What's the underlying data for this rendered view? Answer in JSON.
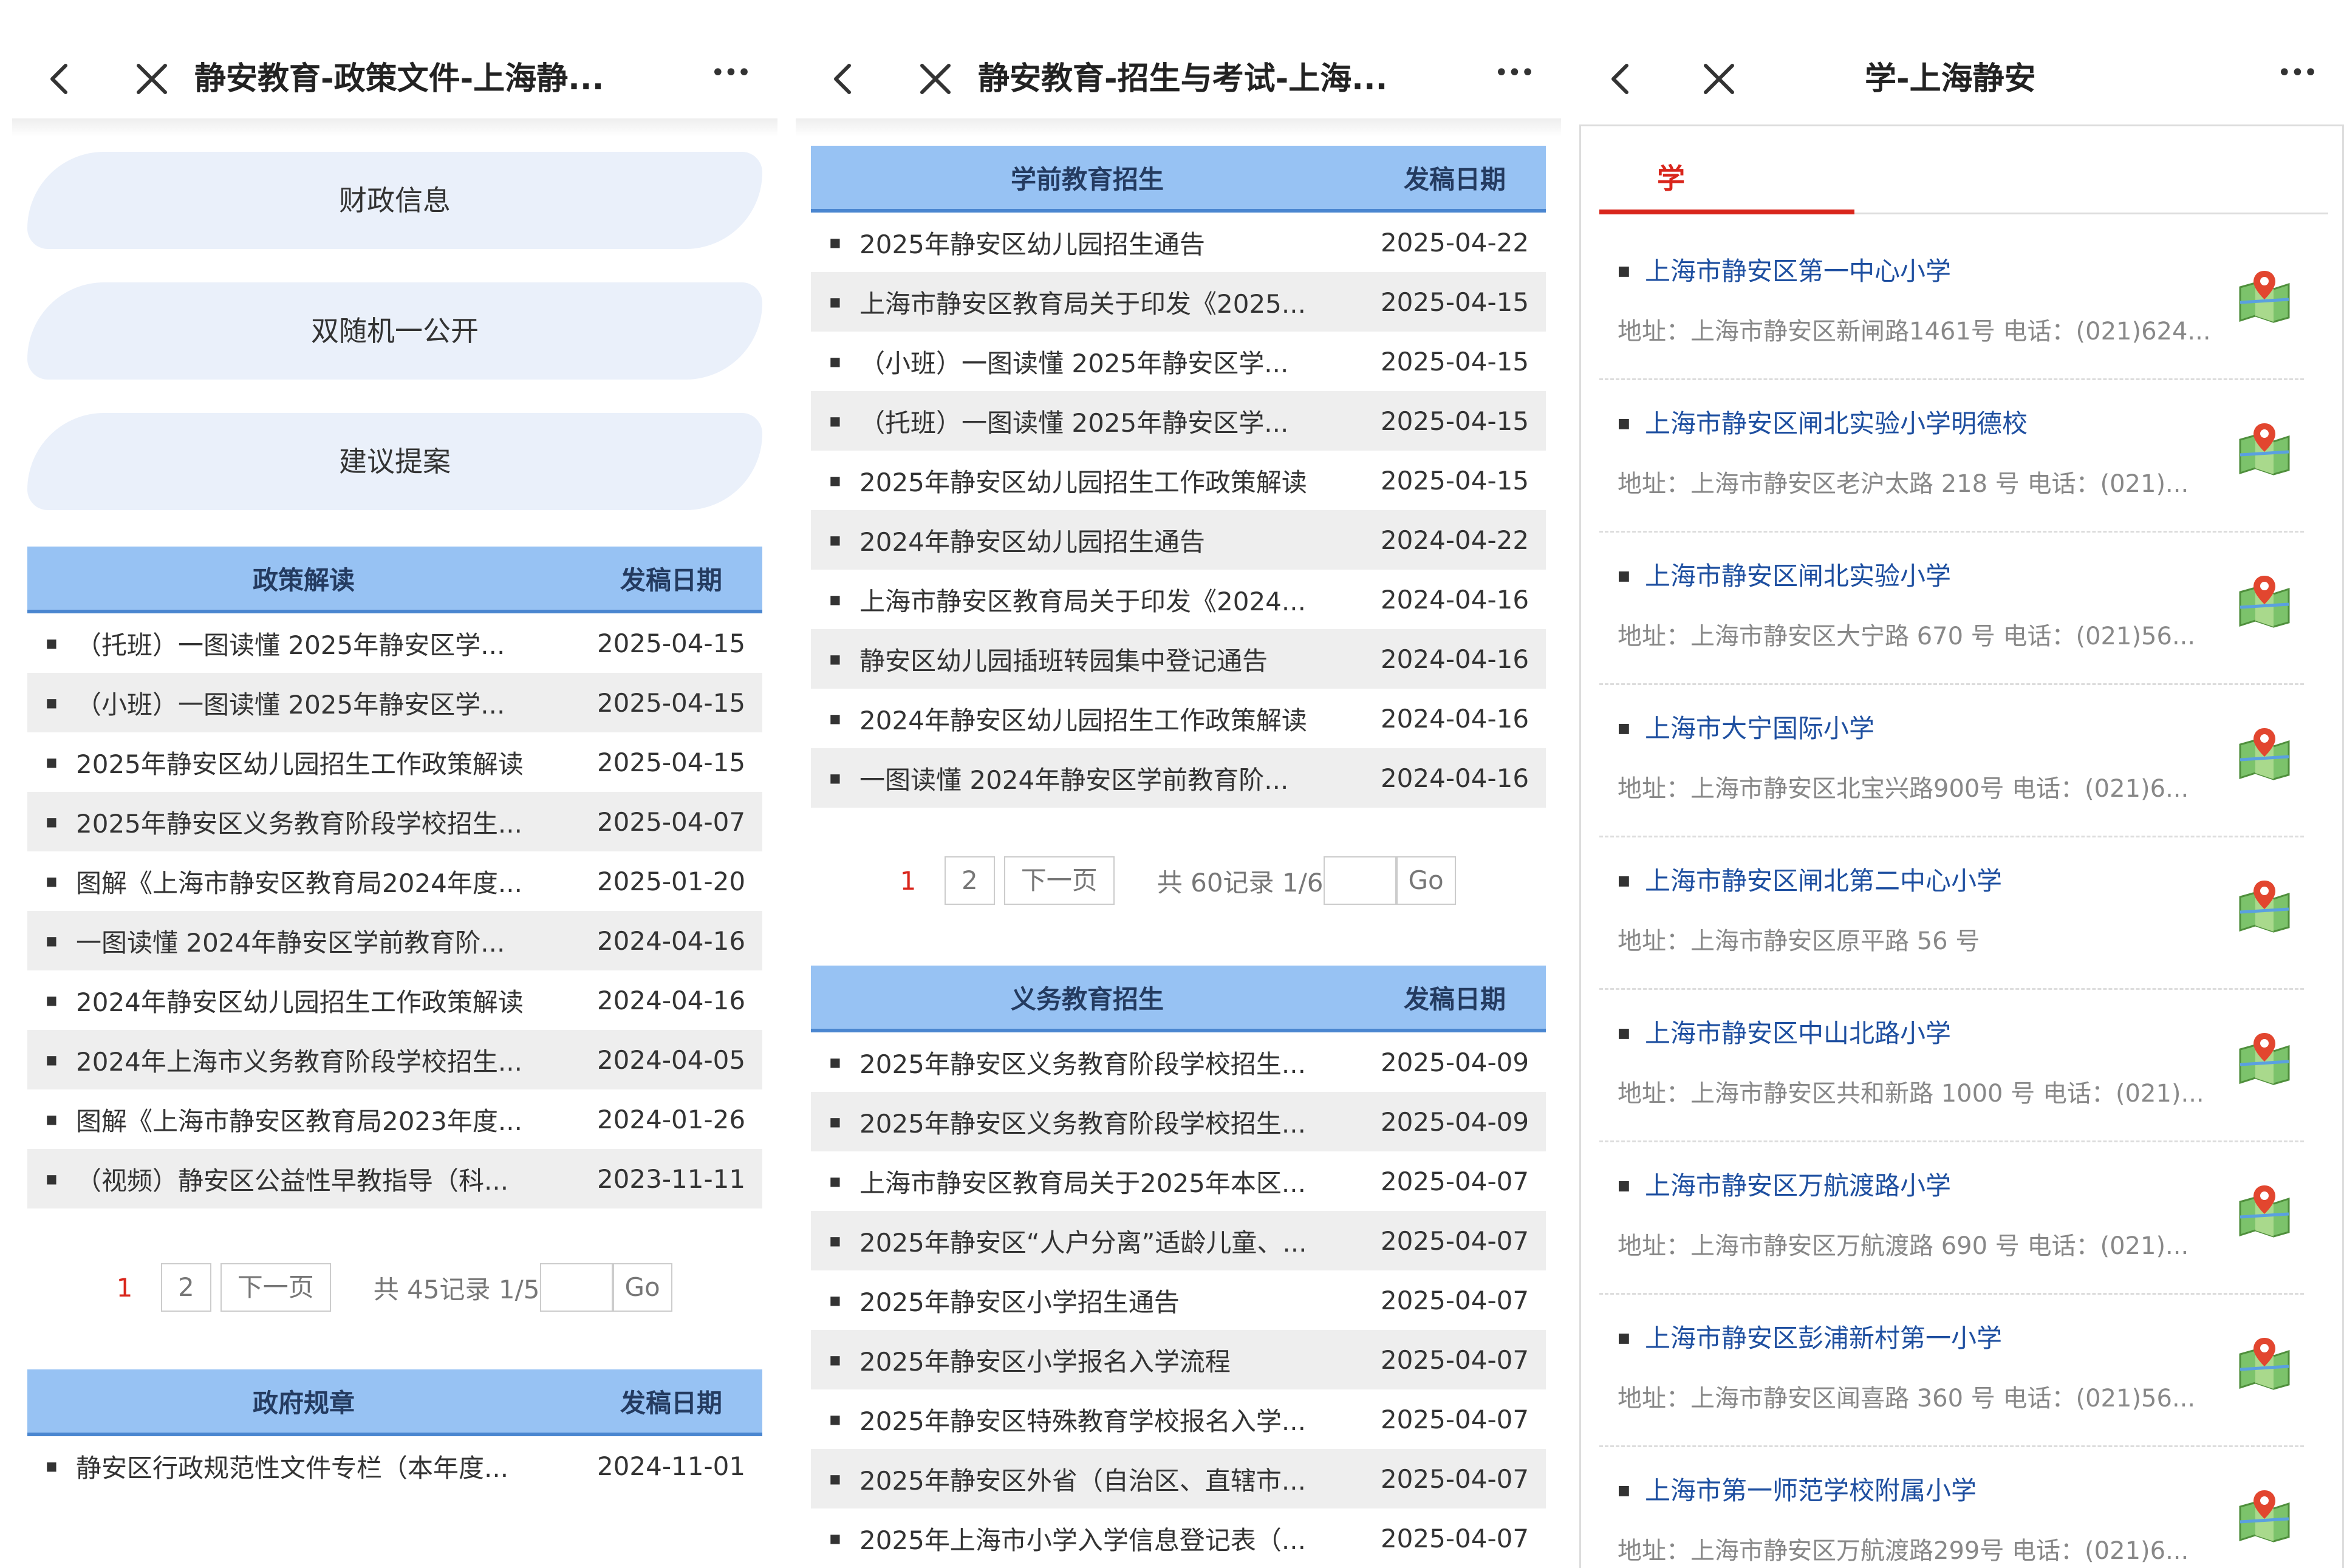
{
  "screen1": {
    "title": "静安教育-政策文件-上海静...",
    "tabs": [
      "财政信息",
      "双随机一公开",
      "建议提案"
    ],
    "table1": {
      "col1": "政策解读",
      "col2": "发稿日期",
      "rows": [
        {
          "text": "（托班）一图读懂 2025年静安区学...",
          "date": "2025-04-15"
        },
        {
          "text": "（小班）一图读懂 2025年静安区学...",
          "date": "2025-04-15"
        },
        {
          "text": "2025年静安区幼儿园招生工作政策解读",
          "date": "2025-04-15"
        },
        {
          "text": "2025年静安区义务教育阶段学校招生...",
          "date": "2025-04-07"
        },
        {
          "text": "图解《上海市静安区教育局2024年度...",
          "date": "2025-01-20"
        },
        {
          "text": "一图读懂 2024年静安区学前教育阶...",
          "date": "2024-04-16"
        },
        {
          "text": "2024年静安区幼儿园招生工作政策解读",
          "date": "2024-04-16"
        },
        {
          "text": "2024年上海市义务教育阶段学校招生...",
          "date": "2024-04-05"
        },
        {
          "text": "图解《上海市静安区教育局2023年度...",
          "date": "2024-01-26"
        },
        {
          "text": "（视频）静安区公益性早教指导（科...",
          "date": "2023-11-11"
        }
      ]
    },
    "pager": {
      "current": "1",
      "page2": "2",
      "next": "下一页",
      "info": "共 45记录 1/5",
      "go": "Go"
    },
    "table2": {
      "col1": "政府规章",
      "col2": "发稿日期",
      "rows": [
        {
          "text": "静安区行政规范性文件专栏（本年度...",
          "date": "2024-11-01"
        }
      ]
    }
  },
  "screen2": {
    "title": "静安教育-招生与考试-上海...",
    "table1": {
      "col1": "学前教育招生",
      "col2": "发稿日期",
      "rows": [
        {
          "text": "2025年静安区幼儿园招生通告",
          "date": "2025-04-22"
        },
        {
          "text": "上海市静安区教育局关于印发《2025...",
          "date": "2025-04-15"
        },
        {
          "text": "（小班）一图读懂 2025年静安区学...",
          "date": "2025-04-15"
        },
        {
          "text": "（托班）一图读懂 2025年静安区学...",
          "date": "2025-04-15"
        },
        {
          "text": "2025年静安区幼儿园招生工作政策解读",
          "date": "2025-04-15"
        },
        {
          "text": "2024年静安区幼儿园招生通告",
          "date": "2024-04-22"
        },
        {
          "text": "上海市静安区教育局关于印发《2024...",
          "date": "2024-04-16"
        },
        {
          "text": "静安区幼儿园插班转园集中登记通告",
          "date": "2024-04-16"
        },
        {
          "text": "2024年静安区幼儿园招生工作政策解读",
          "date": "2024-04-16"
        },
        {
          "text": "一图读懂 2024年静安区学前教育阶...",
          "date": "2024-04-16"
        }
      ]
    },
    "pager": {
      "current": "1",
      "page2": "2",
      "next": "下一页",
      "info": "共 60记录 1/6",
      "go": "Go"
    },
    "table2": {
      "col1": "义务教育招生",
      "col2": "发稿日期",
      "rows": [
        {
          "text": "2025年静安区义务教育阶段学校招生...",
          "date": "2025-04-09"
        },
        {
          "text": "2025年静安区义务教育阶段学校招生...",
          "date": "2025-04-09"
        },
        {
          "text": "上海市静安区教育局关于2025年本区...",
          "date": "2025-04-07"
        },
        {
          "text": "2025年静安区“人户分离”适龄儿童、...",
          "date": "2025-04-07"
        },
        {
          "text": "2025年静安区小学招生通告",
          "date": "2025-04-07"
        },
        {
          "text": "2025年静安区小学报名入学流程",
          "date": "2025-04-07"
        },
        {
          "text": "2025年静安区特殊教育学校报名入学...",
          "date": "2025-04-07"
        },
        {
          "text": "2025年静安区外省（自治区、直辖市...",
          "date": "2025-04-07"
        },
        {
          "text": "2025年上海市小学入学信息登记表（...",
          "date": "2025-04-07"
        }
      ]
    }
  },
  "screen3": {
    "title": "学-上海静安",
    "tab": "学",
    "schools": [
      {
        "name": "上海市静安区第一中心小学",
        "addr": "地址：上海市静安区新闸路1461号  电话：(021)624..."
      },
      {
        "name": "上海市静安区闸北实验小学明德校",
        "addr": "地址：上海市静安区老沪太路 218 号  电话：(021)..."
      },
      {
        "name": "上海市静安区闸北实验小学",
        "addr": "地址：上海市静安区大宁路 670 号  电话：(021)56..."
      },
      {
        "name": "上海市大宁国际小学",
        "addr": "地址：上海市静安区北宝兴路900号  电话：(021)6..."
      },
      {
        "name": "上海市静安区闸北第二中心小学",
        "addr": "地址：上海市静安区原平路 56 号"
      },
      {
        "name": "上海市静安区中山北路小学",
        "addr": "地址：上海市静安区共和新路 1000 号  电话：(021)..."
      },
      {
        "name": "上海市静安区万航渡路小学",
        "addr": "地址：上海市静安区万航渡路 690 号  电话：(021)..."
      },
      {
        "name": "上海市静安区彭浦新村第一小学",
        "addr": "地址：上海市静安区闻喜路 360 号  电话：(021)56..."
      },
      {
        "name": "上海市第一师范学校附属小学",
        "addr": "地址：上海市静安区万航渡路299号  电话：(021)6..."
      }
    ]
  },
  "colors": {
    "accent_red": "#d9261c",
    "header_blue": "#97c2f3",
    "link_blue": "#1e4fa0",
    "pill_bg": "#eaf0fa"
  }
}
